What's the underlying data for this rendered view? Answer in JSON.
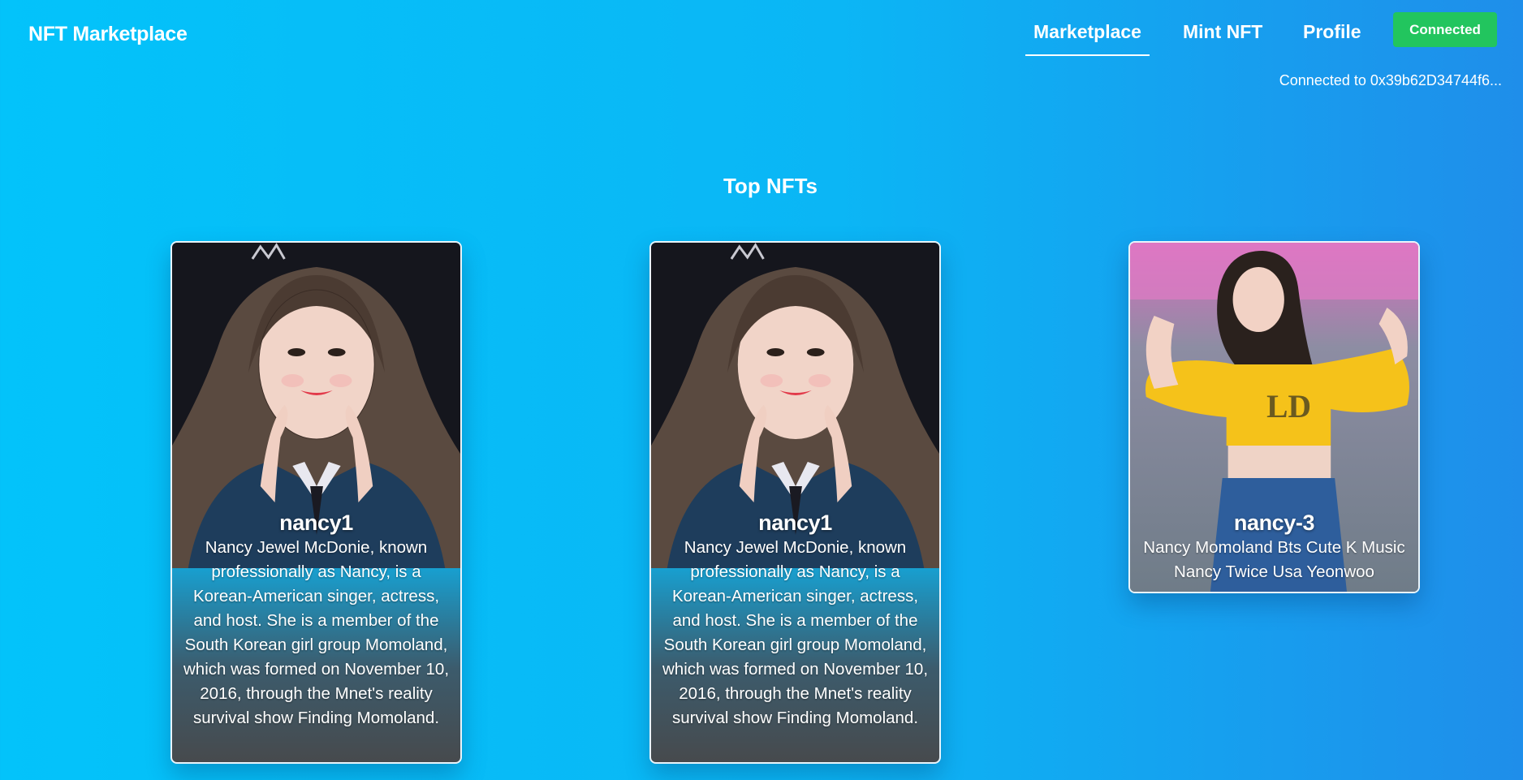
{
  "header": {
    "brand": "NFT Marketplace",
    "nav": [
      {
        "label": "Marketplace",
        "active": true
      },
      {
        "label": "Mint NFT",
        "active": false
      },
      {
        "label": "Profile",
        "active": false
      }
    ],
    "wallet_button": "Connected",
    "wallet_status": "Connected to 0x39b62D34744f6..."
  },
  "main": {
    "title": "Top NFTs",
    "cards": [
      {
        "name": "nancy1",
        "description": "Nancy Jewel McDonie, known professionally as Nancy, is a Korean-American singer, actress, and host. She is a member of the South Korean girl group Momoland, which was formed on November 10, 2016, through the Mnet's reality survival show Finding Momoland.",
        "image": "portrait-photo"
      },
      {
        "name": "nancy1",
        "description": "Nancy Jewel McDonie, known professionally as Nancy, is a Korean-American singer, actress, and host. She is a member of the South Korean girl group Momoland, which was formed on November 10, 2016, through the Mnet's reality survival show Finding Momoland.",
        "image": "portrait-photo"
      },
      {
        "name": "nancy-3",
        "description": "Nancy Momoland Bts Cute K Music Nancy Twice Usa Yeonwoo",
        "image": "stage-photo"
      }
    ]
  },
  "colors": {
    "bg_start": "#03c3fa",
    "bg_end": "#1f8eea",
    "connected_button": "#22c55e"
  }
}
